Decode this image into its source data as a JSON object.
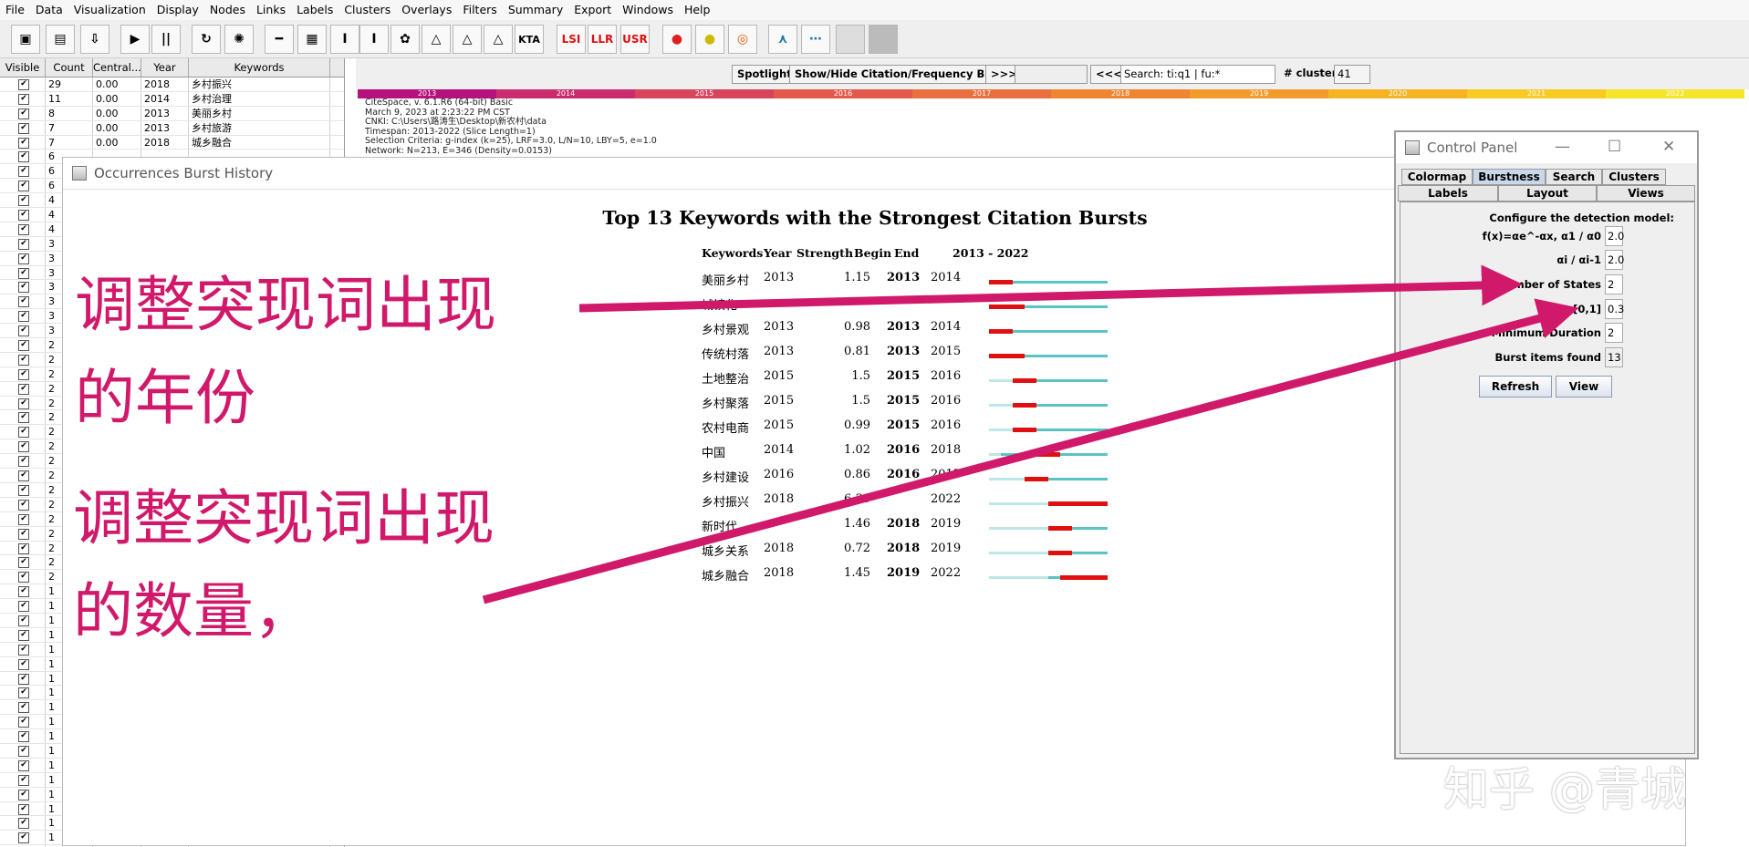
{
  "menu": [
    "File",
    "Data",
    "Visualization",
    "Display",
    "Nodes",
    "Links",
    "Labels",
    "Clusters",
    "Overlays",
    "Filters",
    "Summary",
    "Export",
    "Windows",
    "Help"
  ],
  "toolbar": {
    "icons": [
      "save-icon",
      "clapperboard-icon",
      "export-pdf-icon",
      "play-icon",
      "pause-icon",
      "rotate-icon",
      "spark-icon",
      "line-icon",
      "grid-icon",
      "text-cursor-icon",
      "text-icon",
      "color-nodes-icon",
      "network-icon",
      "network-alt-icon",
      "network-third-icon",
      "kta-icon",
      "lsi-icon",
      "llr-icon",
      "usr-icon",
      "cluster-color-icon",
      "cluster-yellow-icon",
      "target-icon",
      "tree-icon",
      "link-icon",
      "blank-icon",
      "blank-icon"
    ],
    "kta_label": "KTA",
    "lsi_label": "LSI",
    "llr_label": "LLR",
    "usr_label": "USR",
    "play_glyph": "▶",
    "pause_glyph": "⏸"
  },
  "table": {
    "headers": [
      "Visible",
      "Count",
      "Central...",
      "Year",
      "Keywords"
    ],
    "check": "✔",
    "rows": [
      {
        "count": "29",
        "centrality": "0.00",
        "year": "2018",
        "keyword": "乡村振兴"
      },
      {
        "count": "11",
        "centrality": "0.00",
        "year": "2014",
        "keyword": "乡村治理"
      },
      {
        "count": "8",
        "centrality": "0.00",
        "year": "2013",
        "keyword": "美丽乡村"
      },
      {
        "count": "7",
        "centrality": "0.00",
        "year": "2013",
        "keyword": "乡村旅游"
      },
      {
        "count": "7",
        "centrality": "0.00",
        "year": "2018",
        "keyword": "城乡融合"
      },
      {
        "count": "6",
        "centrality": "",
        "year": "",
        "keyword": ""
      },
      {
        "count": "6",
        "centrality": "",
        "year": "",
        "keyword": ""
      },
      {
        "count": "6",
        "centrality": "",
        "year": "",
        "keyword": ""
      },
      {
        "count": "4",
        "centrality": "",
        "year": "",
        "keyword": ""
      },
      {
        "count": "4",
        "centrality": "",
        "year": "",
        "keyword": ""
      },
      {
        "count": "4",
        "centrality": "",
        "year": "",
        "keyword": ""
      },
      {
        "count": "3",
        "centrality": "",
        "year": "",
        "keyword": ""
      },
      {
        "count": "3",
        "centrality": "",
        "year": "",
        "keyword": ""
      },
      {
        "count": "3",
        "centrality": "",
        "year": "",
        "keyword": ""
      },
      {
        "count": "3",
        "centrality": "",
        "year": "",
        "keyword": ""
      },
      {
        "count": "3",
        "centrality": "",
        "year": "",
        "keyword": ""
      },
      {
        "count": "3",
        "centrality": "",
        "year": "",
        "keyword": ""
      },
      {
        "count": "3",
        "centrality": "",
        "year": "",
        "keyword": ""
      },
      {
        "count": "2",
        "centrality": "",
        "year": "",
        "keyword": ""
      },
      {
        "count": "2",
        "centrality": "",
        "year": "",
        "keyword": ""
      },
      {
        "count": "2",
        "centrality": "",
        "year": "",
        "keyword": ""
      },
      {
        "count": "2",
        "centrality": "",
        "year": "",
        "keyword": ""
      },
      {
        "count": "2",
        "centrality": "",
        "year": "",
        "keyword": ""
      },
      {
        "count": "2",
        "centrality": "",
        "year": "",
        "keyword": ""
      },
      {
        "count": "2",
        "centrality": "",
        "year": "",
        "keyword": ""
      },
      {
        "count": "2",
        "centrality": "",
        "year": "",
        "keyword": ""
      },
      {
        "count": "2",
        "centrality": "",
        "year": "",
        "keyword": ""
      },
      {
        "count": "2",
        "centrality": "",
        "year": "",
        "keyword": ""
      },
      {
        "count": "2",
        "centrality": "",
        "year": "",
        "keyword": ""
      },
      {
        "count": "2",
        "centrality": "",
        "year": "",
        "keyword": ""
      },
      {
        "count": "2",
        "centrality": "",
        "year": "",
        "keyword": ""
      },
      {
        "count": "2",
        "centrality": "",
        "year": "",
        "keyword": ""
      },
      {
        "count": "2",
        "centrality": "",
        "year": "",
        "keyword": ""
      },
      {
        "count": "2",
        "centrality": "",
        "year": "",
        "keyword": ""
      },
      {
        "count": "2",
        "centrality": "",
        "year": "",
        "keyword": ""
      },
      {
        "count": "1",
        "centrality": "",
        "year": "",
        "keyword": ""
      },
      {
        "count": "1",
        "centrality": "",
        "year": "",
        "keyword": ""
      },
      {
        "count": "1",
        "centrality": "",
        "year": "",
        "keyword": ""
      },
      {
        "count": "1",
        "centrality": "",
        "year": "",
        "keyword": ""
      },
      {
        "count": "1",
        "centrality": "",
        "year": "",
        "keyword": ""
      },
      {
        "count": "1",
        "centrality": "",
        "year": "",
        "keyword": ""
      },
      {
        "count": "1",
        "centrality": "",
        "year": "",
        "keyword": ""
      },
      {
        "count": "1",
        "centrality": "",
        "year": "",
        "keyword": ""
      },
      {
        "count": "1",
        "centrality": "",
        "year": "",
        "keyword": ""
      },
      {
        "count": "1",
        "centrality": "",
        "year": "",
        "keyword": ""
      },
      {
        "count": "1",
        "centrality": "",
        "year": "",
        "keyword": ""
      },
      {
        "count": "1",
        "centrality": "",
        "year": "",
        "keyword": ""
      },
      {
        "count": "1",
        "centrality": "",
        "year": "",
        "keyword": ""
      },
      {
        "count": "1",
        "centrality": "",
        "year": "",
        "keyword": ""
      },
      {
        "count": "1",
        "centrality": "",
        "year": "",
        "keyword": ""
      },
      {
        "count": "1",
        "centrality": "",
        "year": "",
        "keyword": ""
      },
      {
        "count": "1",
        "centrality": "",
        "year": "",
        "keyword": ""
      },
      {
        "count": "1",
        "centrality": "",
        "year": "",
        "keyword": ""
      },
      {
        "count": "1",
        "centrality": "",
        "year": "",
        "keyword": ""
      }
    ]
  },
  "controls": {
    "spotlight": "Spotlight",
    "show_hide": "Show/Hide Citation/Frequency Burst",
    "next": ">>>",
    "prev": "<<<",
    "search_value": "Search: ti:q1 | fu:*",
    "clusters_label": "# clusters",
    "clusters_value": "41"
  },
  "timeline": {
    "years": [
      "2013",
      "2014",
      "2015",
      "2016",
      "2017",
      "2018",
      "2019",
      "2020",
      "2021",
      "2022"
    ],
    "colors": [
      "#b5127e",
      "#c92d6e",
      "#d9445d",
      "#e35a4c",
      "#ea6f3e",
      "#ef8533",
      "#f39b2a",
      "#f6b324",
      "#f8cb22",
      "#f6e52a"
    ]
  },
  "info": [
    "CiteSpace, v. 6.1.R6 (64-bit) Basic",
    "March 9, 2023 at 2:23:22 PM CST",
    "CNKI: C:\\Users\\路涛生\\Desktop\\新农村\\data",
    "Timespan: 2013-2022 (Slice Length=1)",
    "Selection Criteria: g-index (k=25), LRF=3.0, L/N=10, LBY=5, e=1.0",
    "Network: N=213, E=346 (Density=0.0153)"
  ],
  "burst_window": {
    "title": "Occurrences Burst History",
    "chart_title": "Top 13 Keywords with the Strongest Citation Bursts",
    "headers": {
      "keywords": "Keywords",
      "year": "Year",
      "strength": "Strength",
      "begin": "Begin",
      "end": "End",
      "range": "2013 - 2022"
    }
  },
  "chart_data": {
    "type": "table",
    "title": "Top 13 Keywords with the Strongest Citation Bursts",
    "range": [
      2013,
      2022
    ],
    "rows": [
      {
        "keyword": "美丽乡村",
        "year": "2013",
        "strength": "1.15",
        "begin": "2013",
        "end": "2014"
      },
      {
        "keyword": "城镇化",
        "year": "",
        "strength": "",
        "begin": "",
        "end": ""
      },
      {
        "keyword": "乡村景观",
        "year": "2013",
        "strength": "0.98",
        "begin": "2013",
        "end": "2014"
      },
      {
        "keyword": "传统村落",
        "year": "2013",
        "strength": "0.81",
        "begin": "2013",
        "end": "2015"
      },
      {
        "keyword": "土地整治",
        "year": "2015",
        "strength": "1.5",
        "begin": "2015",
        "end": "2016"
      },
      {
        "keyword": "乡村聚落",
        "year": "2015",
        "strength": "1.5",
        "begin": "2015",
        "end": "2016"
      },
      {
        "keyword": "农村电商",
        "year": "2015",
        "strength": "0.99",
        "begin": "2015",
        "end": "2016"
      },
      {
        "keyword": "中国",
        "year": "2014",
        "strength": "1.02",
        "begin": "2016",
        "end": "2018"
      },
      {
        "keyword": "乡村建设",
        "year": "2016",
        "strength": "0.86",
        "begin": "2016",
        "end": "2017"
      },
      {
        "keyword": "乡村振兴",
        "year": "2018",
        "strength": "6.39",
        "begin": "",
        "end": "2022"
      },
      {
        "keyword": "新时代",
        "year": "",
        "strength": "1.46",
        "begin": "2018",
        "end": "2019"
      },
      {
        "keyword": "城乡关系",
        "year": "2018",
        "strength": "0.72",
        "begin": "2018",
        "end": "2019"
      },
      {
        "keyword": "城乡融合",
        "year": "2018",
        "strength": "1.45",
        "begin": "2019",
        "end": "2022"
      }
    ],
    "bars": [
      {
        "year": 2013,
        "begin": 2013,
        "end": 2014
      },
      {
        "year": 2013,
        "begin": 2013,
        "end": 2015
      },
      {
        "year": 2013,
        "begin": 2013,
        "end": 2014
      },
      {
        "year": 2013,
        "begin": 2013,
        "end": 2015
      },
      {
        "year": 2015,
        "begin": 2015,
        "end": 2016
      },
      {
        "year": 2015,
        "begin": 2015,
        "end": 2016
      },
      {
        "year": 2015,
        "begin": 2015,
        "end": 2016
      },
      {
        "year": 2014,
        "begin": 2016,
        "end": 2018
      },
      {
        "year": 2016,
        "begin": 2016,
        "end": 2017
      },
      {
        "year": 2018,
        "begin": 2018,
        "end": 2022
      },
      {
        "year": 2018,
        "begin": 2018,
        "end": 2019
      },
      {
        "year": 2018,
        "begin": 2018,
        "end": 2019
      },
      {
        "year": 2018,
        "begin": 2019,
        "end": 2022
      }
    ],
    "colors": {
      "burst": "#e01010",
      "active": "#5cc3c3",
      "inactive": "#bfe6e6"
    }
  },
  "control_panel": {
    "title": "Control Panel",
    "tabs_row1": [
      "Colormap",
      "Burstness",
      "Search",
      "Clusters"
    ],
    "tabs_row2": [
      "Labels",
      "Layout",
      "Views"
    ],
    "configure": "Configure the detection model:",
    "fields": [
      {
        "label": "f(x)=αe^-αx, α1 / α0",
        "value": "2.0"
      },
      {
        "label": "αi / αi-1",
        "value": "2.0"
      },
      {
        "label": "Number of States",
        "value": "2"
      },
      {
        "label": "γ[0,1]",
        "value": "0.3"
      },
      {
        "label": "Minimum Duration",
        "value": "2"
      },
      {
        "label": "Burst items found",
        "value": "13"
      }
    ],
    "refresh": "Refresh",
    "view": "View",
    "min_glyph": "—",
    "max_glyph": "☐",
    "close_glyph": "✕"
  },
  "annotations": {
    "line1": "调整突现词出现",
    "line2": "的年份",
    "line3": "调整突现词出现",
    "line4": "的数量，",
    "color": "#d0196a"
  },
  "watermark": "知乎 @青城"
}
